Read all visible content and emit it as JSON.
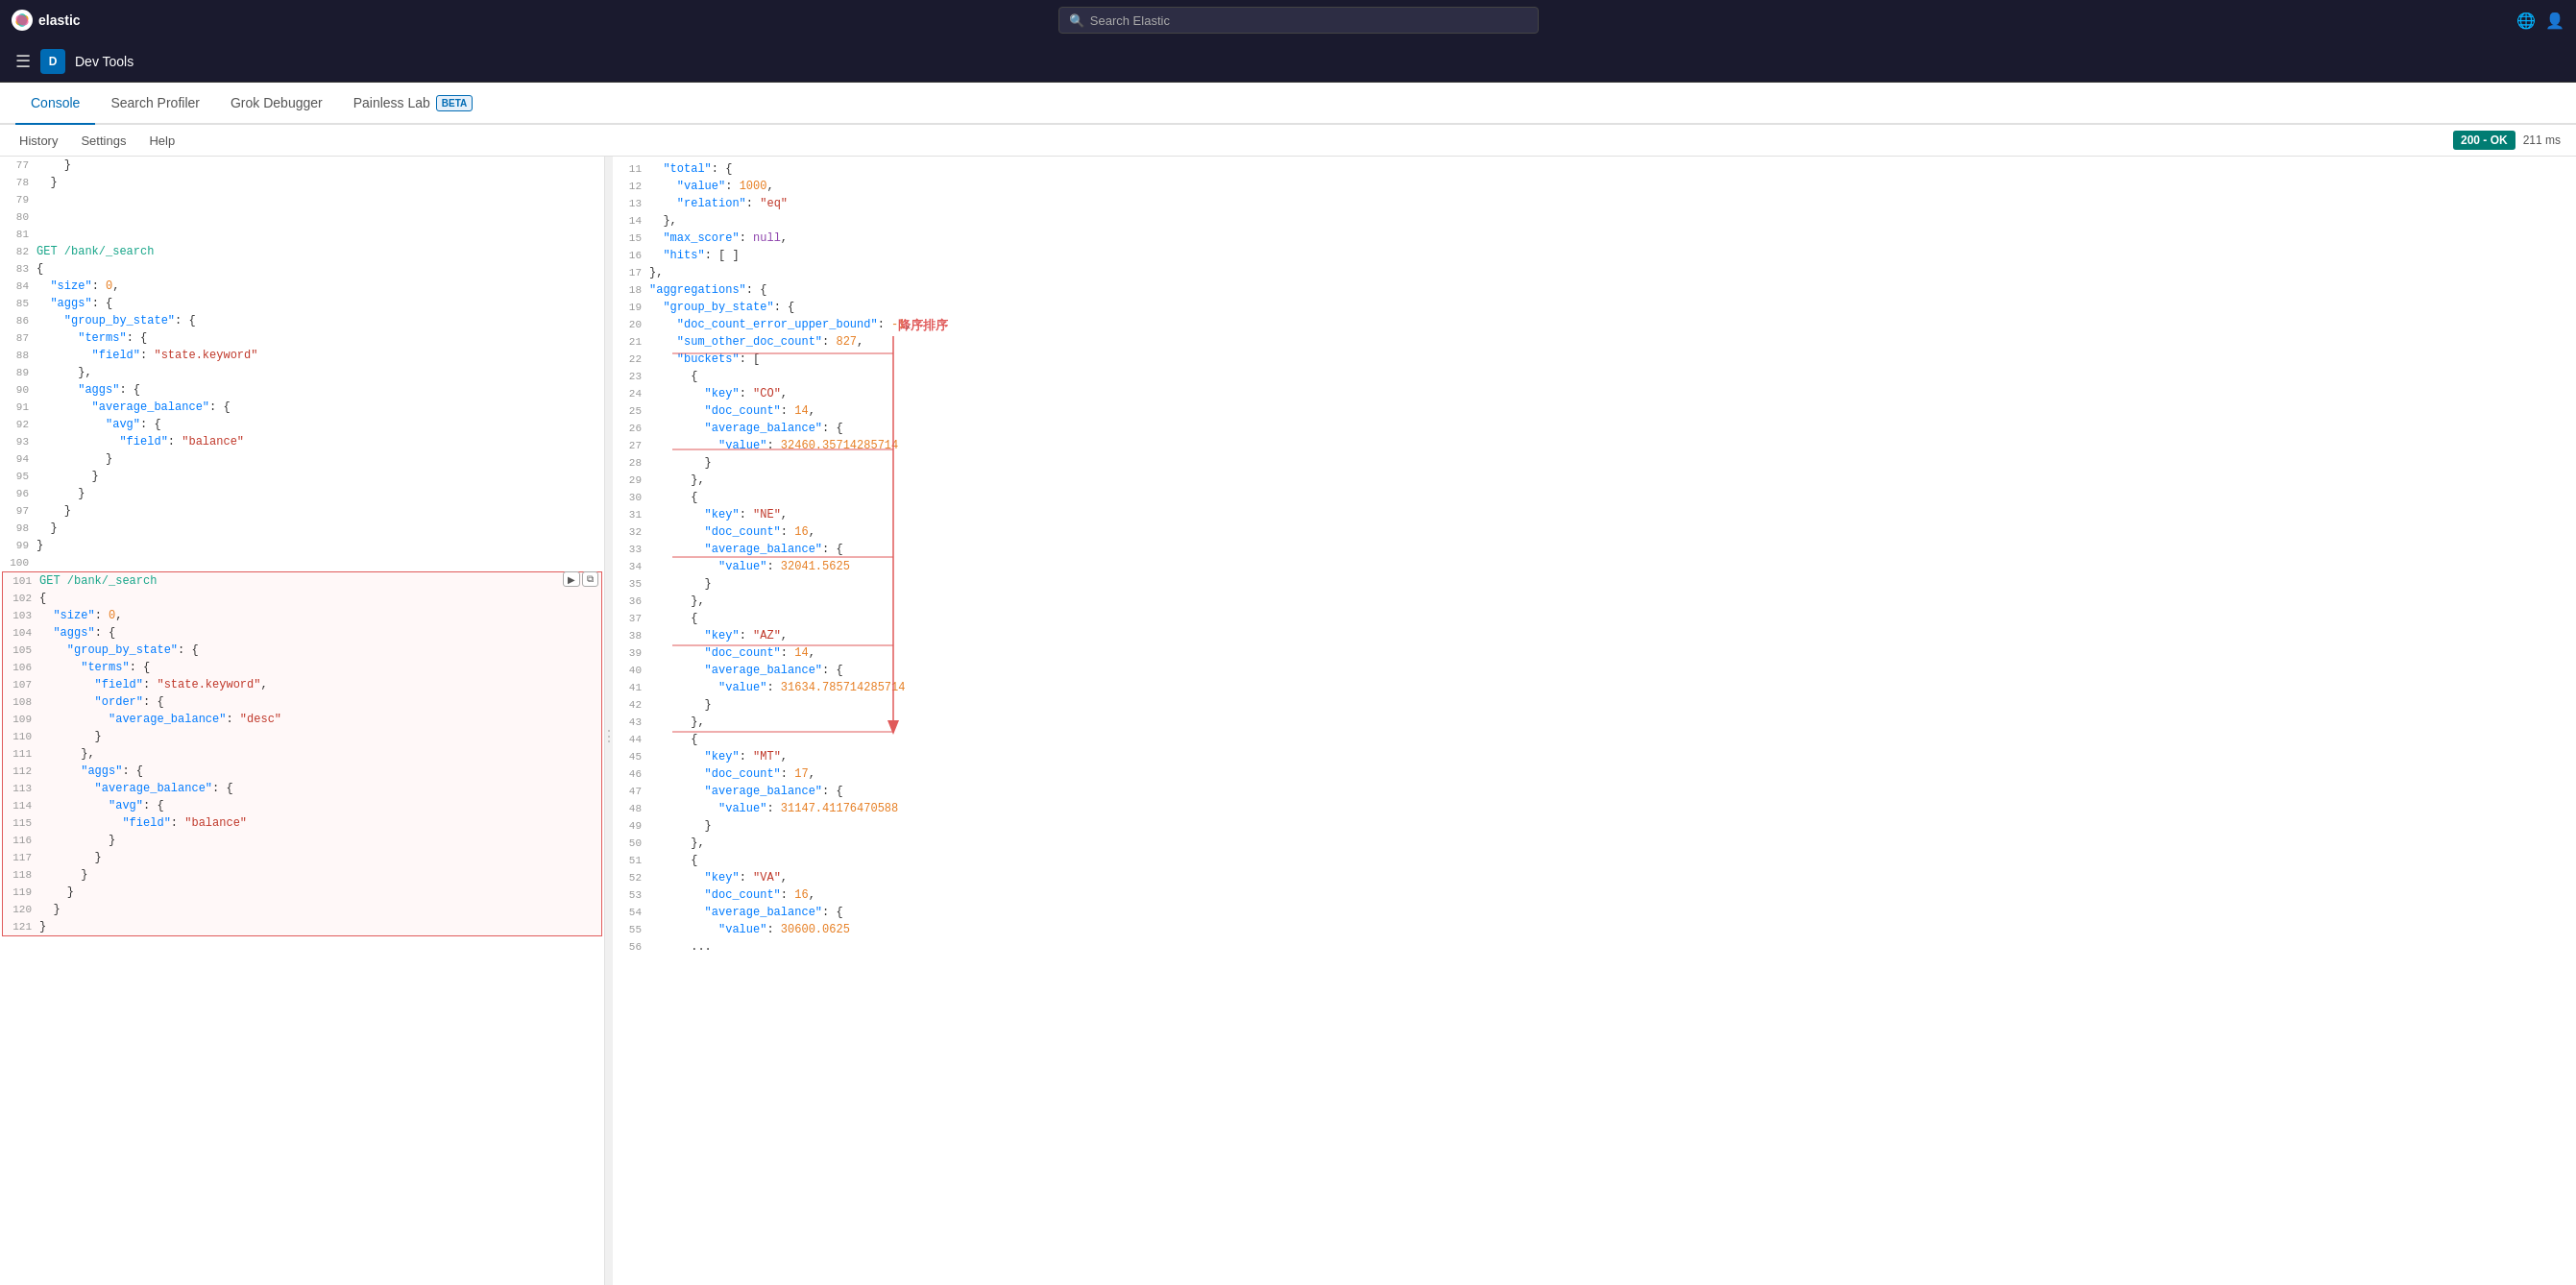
{
  "topBar": {
    "logoText": "elastic",
    "searchPlaceholder": "Search Elastic",
    "icons": [
      "globe-icon",
      "user-icon"
    ]
  },
  "secondBar": {
    "appLabel": "Dev Tools",
    "avatarLetter": "D"
  },
  "tabs": [
    {
      "id": "console",
      "label": "Console",
      "active": true
    },
    {
      "id": "search-profiler",
      "label": "Search Profiler",
      "active": false
    },
    {
      "id": "grok-debugger",
      "label": "Grok Debugger",
      "active": false
    },
    {
      "id": "painless-lab",
      "label": "Painless Lab",
      "active": false,
      "beta": true
    }
  ],
  "actionBar": {
    "historyLabel": "History",
    "settingsLabel": "Settings",
    "helpLabel": "Help",
    "statusCode": "200 - OK",
    "statusTime": "211 ms"
  },
  "betaLabel": "BETA",
  "editor": {
    "lines": [
      {
        "num": 77,
        "content": "    }"
      },
      {
        "num": 78,
        "content": "  }"
      },
      {
        "num": 79,
        "content": ""
      },
      {
        "num": 80,
        "content": ""
      },
      {
        "num": 81,
        "content": ""
      },
      {
        "num": 82,
        "content": "GET /bank/_search"
      },
      {
        "num": 83,
        "content": "{"
      },
      {
        "num": 84,
        "content": "  \"size\": 0,"
      },
      {
        "num": 85,
        "content": "  \"aggs\": {"
      },
      {
        "num": 86,
        "content": "    \"group_by_state\": {"
      },
      {
        "num": 87,
        "content": "      \"terms\": {"
      },
      {
        "num": 88,
        "content": "        \"field\": \"state.keyword\""
      },
      {
        "num": 89,
        "content": "      },"
      },
      {
        "num": 90,
        "content": "      \"aggs\": {"
      },
      {
        "num": 91,
        "content": "        \"average_balance\": {"
      },
      {
        "num": 92,
        "content": "          \"avg\": {"
      },
      {
        "num": 93,
        "content": "            \"field\": \"balance\""
      },
      {
        "num": 94,
        "content": "          }"
      },
      {
        "num": 95,
        "content": "        }"
      },
      {
        "num": 96,
        "content": "      }"
      },
      {
        "num": 97,
        "content": "    }"
      },
      {
        "num": 98,
        "content": "  }"
      },
      {
        "num": 99,
        "content": "}"
      },
      {
        "num": 100,
        "content": ""
      }
    ],
    "highlightedLines": [
      {
        "num": 101,
        "content": "GET /bank/_search",
        "isCommand": true
      },
      {
        "num": 102,
        "content": "{"
      },
      {
        "num": 103,
        "content": "  \"size\": 0,"
      },
      {
        "num": 104,
        "content": "  \"aggs\": {"
      },
      {
        "num": 105,
        "content": "    \"group_by_state\": {"
      },
      {
        "num": 106,
        "content": "      \"terms\": {"
      },
      {
        "num": 107,
        "content": "        \"field\": \"state.keyword\","
      },
      {
        "num": 108,
        "content": "        \"order\": {"
      },
      {
        "num": 109,
        "content": "          \"average_balance\": \"desc\""
      },
      {
        "num": 110,
        "content": "        }"
      },
      {
        "num": 111,
        "content": "      },"
      },
      {
        "num": 112,
        "content": "      \"aggs\": {"
      },
      {
        "num": 113,
        "content": "        \"average_balance\": {"
      },
      {
        "num": 114,
        "content": "          \"avg\": {"
      },
      {
        "num": 115,
        "content": "            \"field\": \"balance\""
      },
      {
        "num": 116,
        "content": "          }"
      },
      {
        "num": 117,
        "content": "        }"
      },
      {
        "num": 118,
        "content": "      }"
      },
      {
        "num": 119,
        "content": "    }"
      },
      {
        "num": 120,
        "content": "  }"
      },
      {
        "num": 121,
        "content": "}"
      }
    ]
  },
  "response": {
    "lines": [
      {
        "num": 11,
        "content": "  \"total\" : {"
      },
      {
        "num": 12,
        "content": "    \"value\" : 1000,"
      },
      {
        "num": 13,
        "content": "    \"relation\" : \"eq\""
      },
      {
        "num": 14,
        "content": "  },"
      },
      {
        "num": 15,
        "content": "  \"max_score\" : null,"
      },
      {
        "num": 16,
        "content": "  \"hits\" : [ ]"
      },
      {
        "num": 17,
        "content": "},"
      },
      {
        "num": 18,
        "content": "\"aggregations\" : {"
      },
      {
        "num": 19,
        "content": "  \"group_by_state\" : {"
      },
      {
        "num": 20,
        "content": "    \"doc_count_error_upper_bound\" : -1,"
      },
      {
        "num": 21,
        "content": "    \"sum_other_doc_count\" : 827,"
      },
      {
        "num": 22,
        "content": "    \"buckets\" : ["
      },
      {
        "num": 23,
        "content": "      {"
      },
      {
        "num": 24,
        "content": "        \"key\" : \"CO\","
      },
      {
        "num": 25,
        "content": "        \"doc_count\" : 14,"
      },
      {
        "num": 26,
        "content": "        \"average_balance\" : {"
      },
      {
        "num": 27,
        "content": "          \"value\" : 32460.35714285714"
      },
      {
        "num": 28,
        "content": "        }"
      },
      {
        "num": 29,
        "content": "      },"
      },
      {
        "num": 30,
        "content": "      {"
      },
      {
        "num": 31,
        "content": "        \"key\" : \"NE\","
      },
      {
        "num": 32,
        "content": "        \"doc_count\" : 16,"
      },
      {
        "num": 33,
        "content": "        \"average_balance\" : {"
      },
      {
        "num": 34,
        "content": "          \"value\" : 32041.5625"
      },
      {
        "num": 35,
        "content": "        }"
      },
      {
        "num": 36,
        "content": "      },"
      },
      {
        "num": 37,
        "content": "      {"
      },
      {
        "num": 38,
        "content": "        \"key\" : \"AZ\","
      },
      {
        "num": 39,
        "content": "        \"doc_count\" : 14,"
      },
      {
        "num": 40,
        "content": "        \"average_balance\" : {"
      },
      {
        "num": 41,
        "content": "          \"value\" : 31634.785714285714"
      },
      {
        "num": 42,
        "content": "        }"
      },
      {
        "num": 43,
        "content": "      },"
      },
      {
        "num": 44,
        "content": "      {"
      },
      {
        "num": 45,
        "content": "        \"key\" : \"MT\","
      },
      {
        "num": 46,
        "content": "        \"doc_count\" : 17,"
      },
      {
        "num": 47,
        "content": "        \"average_balance\" : {"
      },
      {
        "num": 48,
        "content": "          \"value\" : 31147.41176470588"
      },
      {
        "num": 49,
        "content": "        }"
      },
      {
        "num": 50,
        "content": "      },"
      },
      {
        "num": 51,
        "content": "      {"
      },
      {
        "num": 52,
        "content": "        \"key\" : \"VA\","
      },
      {
        "num": 53,
        "content": "        \"doc_count\" : 16,"
      },
      {
        "num": 54,
        "content": "        \"average_balance\" : {"
      },
      {
        "num": 55,
        "content": "          \"value\" : 30600.0625"
      },
      {
        "num": 56,
        "content": "      ..."
      }
    ]
  },
  "annotation": {
    "text": "降序排序"
  }
}
